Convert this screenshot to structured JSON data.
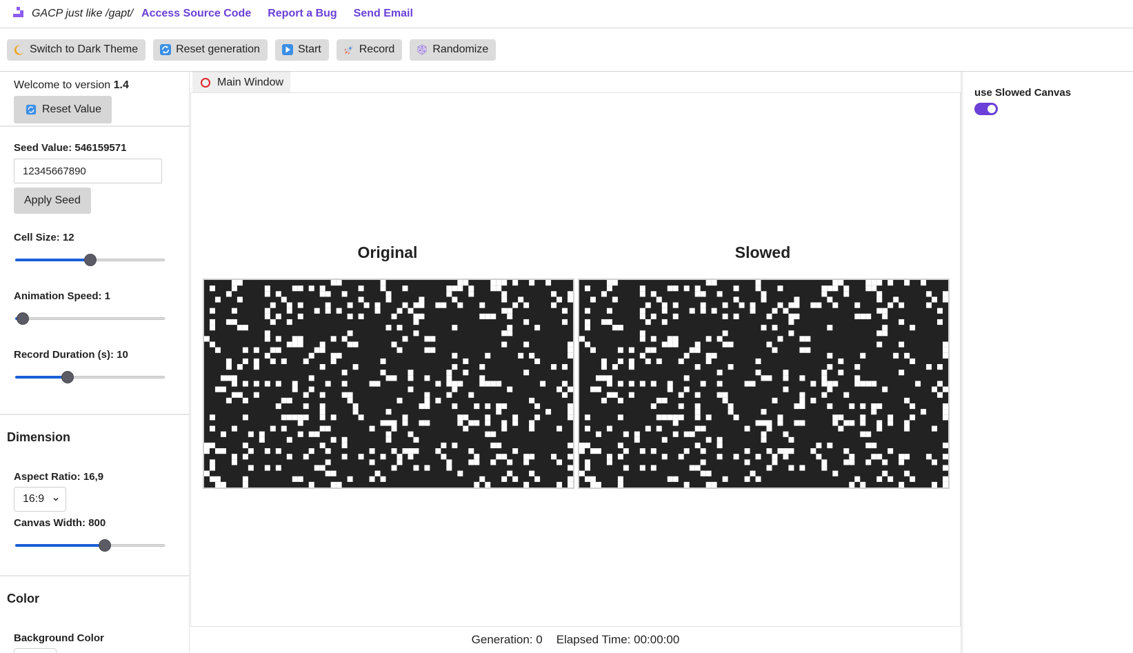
{
  "nav": {
    "brand": "GACP just like /gapt/",
    "links": [
      "Access Source Code",
      "Report a Bug",
      "Send Email"
    ],
    "accent": "#6a40d8"
  },
  "toolbar": {
    "buttons": [
      {
        "label": "Switch to Dark Theme",
        "icon": "moon-icon"
      },
      {
        "label": "Reset generation",
        "icon": "refresh-icon"
      },
      {
        "label": "Start",
        "icon": "play-icon"
      },
      {
        "label": "Record",
        "icon": "rocket-icon"
      },
      {
        "label": "Randomize",
        "icon": "dice-icon"
      }
    ]
  },
  "left": {
    "welcome_prefix": "Welcome to version",
    "version": "1.4",
    "reset_value_label": "Reset Value",
    "seed_label": "Seed Value: 546159571",
    "seed_input_value": "12345667890",
    "apply_seed_label": "Apply Seed",
    "cell_size_label": "Cell Size: 12",
    "cell_size_level": 0.5,
    "animation_speed_label": "Animation Speed: 1",
    "animation_speed_level": 0.05,
    "record_duration_label": "Record Duration (s): 10",
    "record_duration_level": 0.35,
    "dimension_title": "Dimension",
    "aspect_ratio_label": "Aspect Ratio: 16,9",
    "aspect_ratio_value": "16:9",
    "canvas_width_label": "Canvas Width: 800",
    "canvas_width_level": 0.6,
    "color_title": "Color",
    "background_color_label": "Background Color"
  },
  "main": {
    "tab_label": "Main Window",
    "original_title": "Original",
    "slowed_title": "Slowed",
    "generation_label": "Generation: 0",
    "elapsed_label": "Elapsed Time: 00:00:00"
  },
  "right": {
    "toggle_label": "use Slowed Canvas",
    "toggle_on": true
  }
}
